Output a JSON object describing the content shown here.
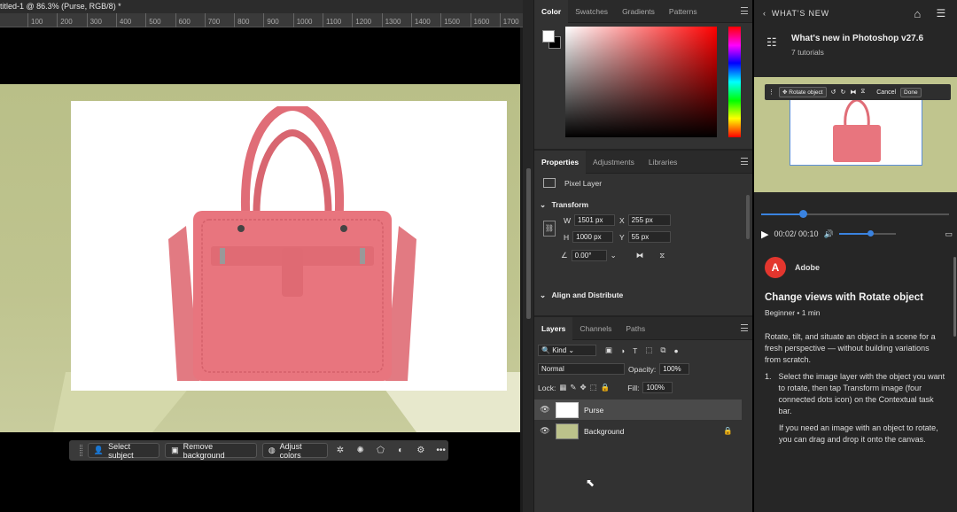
{
  "document": {
    "tab_title": "titled-1 @ 86.3% (Purse, RGB/8) *",
    "ruler_ticks": [
      "100",
      "200",
      "300",
      "400",
      "500",
      "600",
      "700",
      "800",
      "900",
      "1000",
      "1100",
      "1200",
      "1300",
      "1400",
      "1500",
      "1600",
      "1700"
    ]
  },
  "taskbar": {
    "select_subject": "Select subject",
    "remove_background": "Remove background",
    "adjust_colors": "Adjust colors"
  },
  "color_panel": {
    "tabs": [
      "Color",
      "Swatches",
      "Gradients",
      "Patterns"
    ],
    "foreground": "#ffffff",
    "background": "#000000"
  },
  "properties_panel": {
    "tabs": [
      "Properties",
      "Adjustments",
      "Libraries"
    ],
    "layer_type": "Pixel Layer",
    "transform_title": "Transform",
    "w_label": "W",
    "w_value": "1501 px",
    "h_label": "H",
    "h_value": "1000 px",
    "x_label": "X",
    "x_value": "255 px",
    "y_label": "Y",
    "y_value": "55 px",
    "angle_value": "0.00°",
    "align_title": "Align and Distribute"
  },
  "layers_panel": {
    "tabs": [
      "Layers",
      "Channels",
      "Paths"
    ],
    "kind_filter": "Kind",
    "blend_mode": "Normal",
    "opacity_label": "Opacity:",
    "opacity_value": "100%",
    "lock_label": "Lock:",
    "fill_label": "Fill:",
    "fill_value": "100%",
    "layers": [
      {
        "name": "Purse",
        "selected": true
      },
      {
        "name": "Background",
        "selected": false,
        "locked": true
      }
    ]
  },
  "help_panel": {
    "header": "WHAT'S NEW",
    "title": "What's new in Photoshop v27.6",
    "subtitle": "7 tutorials",
    "video_toolbar": {
      "rotate_label": "Rotate object",
      "cancel": "Cancel",
      "done": "Done"
    },
    "time": "00:02/ 00:10",
    "progress_fraction": 0.22,
    "volume_fraction": 0.55,
    "author": "Adobe",
    "tutorial_title": "Change views with Rotate object",
    "level": "Beginner",
    "duration": "1 min",
    "intro": "Rotate, tilt, and situate an object in a scene for a fresh perspective — without building variations from scratch.",
    "step1_number": "1.",
    "step1": "Select the image layer with the object you want to rotate, then tap Transform image (four connected dots icon) on the Contextual task bar.",
    "step1_note": "If you need an image with an object to rotate, you can drag and drop it onto the canvas."
  },
  "colors": {
    "accent": "#3a83e0",
    "purse": "#e8757e",
    "canvas_green": "#bcc28b",
    "adobe_red": "#e3362e"
  }
}
